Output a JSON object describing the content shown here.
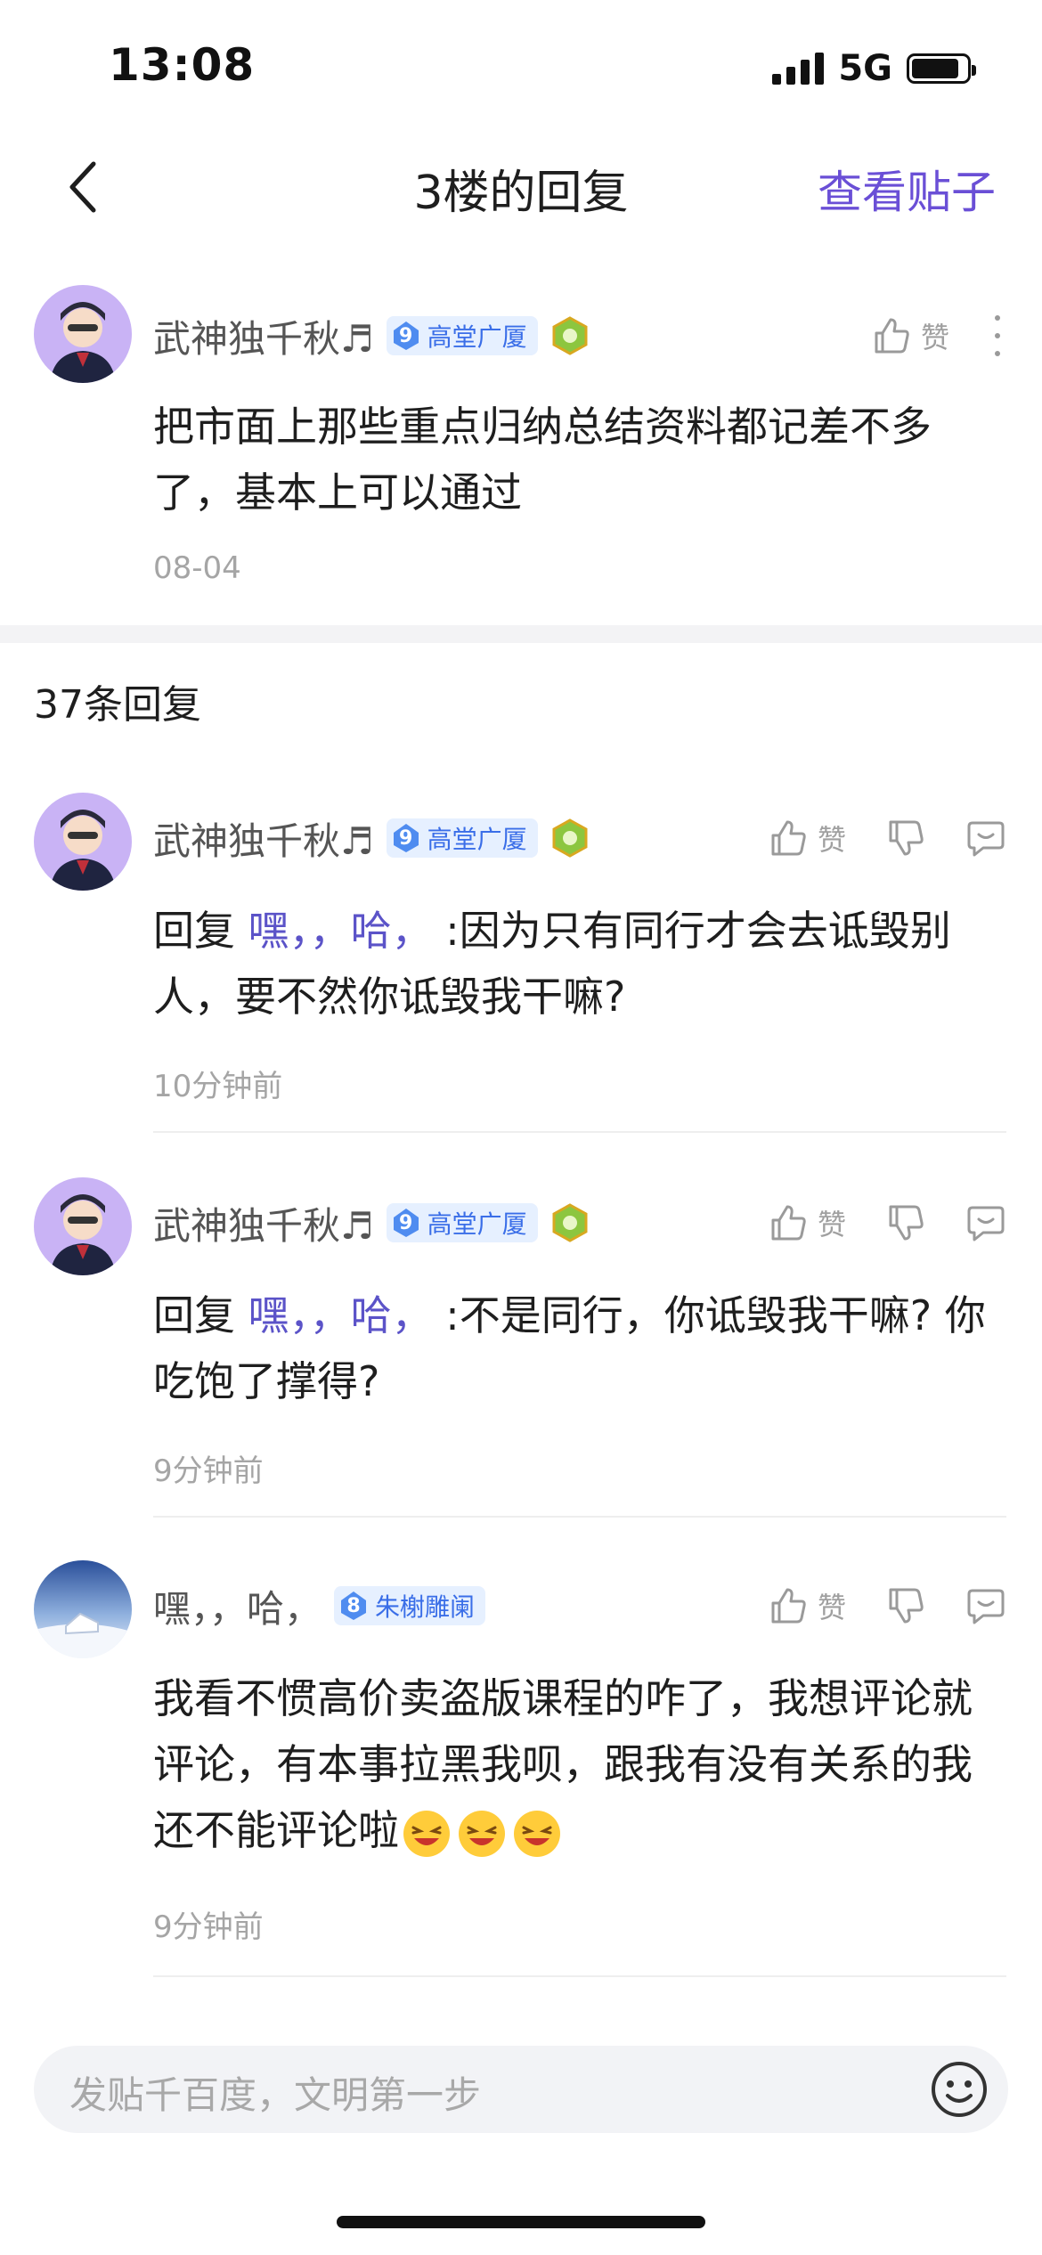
{
  "status_bar": {
    "time": "13:08",
    "network": "5G"
  },
  "header": {
    "title": "3楼的回复",
    "view_post_label": "查看贴子"
  },
  "main_comment": {
    "user_name": "武神独千秋♬",
    "level": "9",
    "badge_text": "高堂广厦",
    "like_label": "赞",
    "text": "把市面上那些重点归纳总结资料都记差不多了，基本上可以通过",
    "time": "08-04"
  },
  "reply_count": "37条回复",
  "replies": [
    {
      "user_name": "武神独千秋♬",
      "level": "9",
      "badge_text": "高堂广厦",
      "like_label": "赞",
      "reply_prefix": "回复",
      "mention": "嘿，，哈，",
      "text": ":因为只有同行才会去诋毁别人，要不然你诋毁我干嘛?",
      "time": "10分钟前"
    },
    {
      "user_name": "武神独千秋♬",
      "level": "9",
      "badge_text": "高堂广厦",
      "like_label": "赞",
      "reply_prefix": "回复",
      "mention": "嘿，，哈，",
      "text": ":不是同行，你诋毁我干嘛? 你吃饱了撑得?",
      "time": "9分钟前"
    },
    {
      "user_name": "嘿，，哈，",
      "level": "8",
      "badge_text": "朱榭雕阑",
      "like_label": "赞",
      "text": "我看不惯高价卖盗版课程的咋了，我想评论就评论，有本事拉黑我呗，跟我有没有关系的我还不能评论啦",
      "emoji_count": 3,
      "time": "9分钟前"
    }
  ],
  "input_bar": {
    "placeholder": "发贴千百度，文明第一步"
  },
  "colors": {
    "accent": "#6a4fd6",
    "mention": "#5b53c8",
    "badge_blue": "#3a6ee8"
  }
}
